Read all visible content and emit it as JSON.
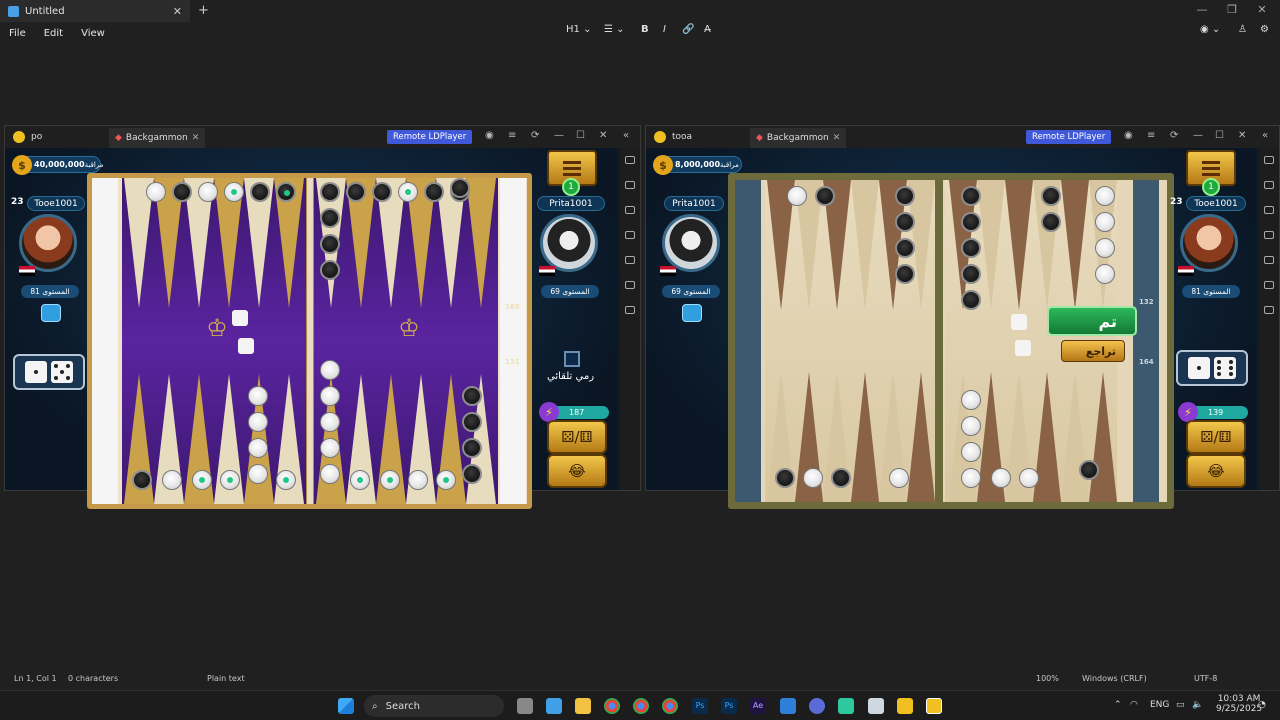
{
  "app": {
    "tab_title": "Untitled",
    "new_tab": "+",
    "menus": [
      "File",
      "Edit",
      "View"
    ],
    "format": {
      "heading": "H1",
      "bold": "B",
      "italic": "I"
    }
  },
  "statusbar": {
    "position": "Ln 1, Col 1",
    "chars": "0 characters",
    "mode": "Plain text",
    "zoom": "100%",
    "eol": "Windows (CRLF)",
    "encoding": "UTF-8"
  },
  "taskbar": {
    "search_placeholder": "Search",
    "lang": "ENG",
    "time": "10:03 AM",
    "date": "9/25/2025"
  },
  "left_window": {
    "instance": "po",
    "tab": "Backgammon",
    "remote": "Remote LDPlayer",
    "coins": "40,000,000",
    "watch_label": "مراقبة",
    "player_name": "Tooe1001",
    "player_badge": "23",
    "player_level": "المستوى 81",
    "opponent_name": "Prita1001",
    "opponent_level": "المستوى 69",
    "green_count": "1",
    "auto_roll_label": "رمي تلقائي",
    "energy": "187",
    "stack_count": "4",
    "pip_top": "169",
    "pip_bottom": "131"
  },
  "right_window": {
    "instance": "tooa",
    "tab": "Backgammon",
    "remote": "Remote LDPlayer",
    "coins": "8,000,000",
    "watch_label": "مراقبة",
    "player_name": "Prita1001",
    "player_level": "المستوى 69",
    "opponent_name": "Tooe1001",
    "opponent_badge": "23",
    "opponent_level": "المستوى 81",
    "green_count": "1",
    "done_label": "تم",
    "undo_label": "تراجع",
    "energy": "139",
    "stack_count": "4",
    "pip_top": "132",
    "pip_bottom": "164"
  }
}
